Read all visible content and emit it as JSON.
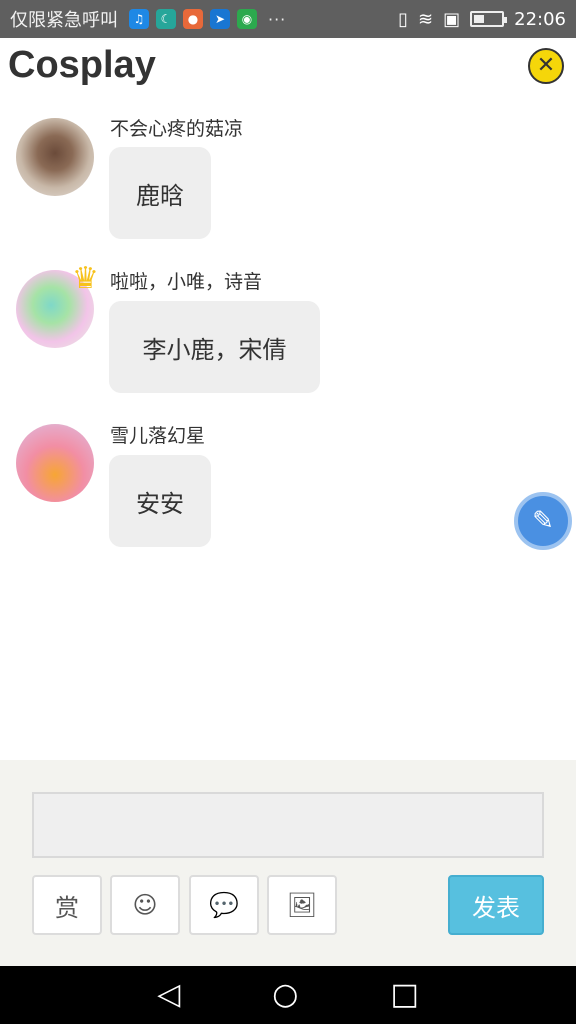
{
  "status_bar": {
    "emergency_text": "仅限紧急呼叫",
    "notification_icons": [
      "qq-icon",
      "moon-icon",
      "weibo-icon",
      "paperplane-icon",
      "wechat-icon"
    ],
    "more": "···",
    "time": "22:06",
    "battery_level": 0.4
  },
  "header": {
    "title": "Cosplay",
    "close_icon": "close-icon"
  },
  "messages": [
    {
      "name": "不会心疼的菇凉",
      "text": "鹿晗"
    },
    {
      "name": "啦啦，小唯，诗音",
      "text": "李小鹿，宋倩"
    },
    {
      "name": "雪儿落幻星",
      "text": "安安"
    }
  ],
  "composer": {
    "input_value": "",
    "reward_label": "赏",
    "send_label": "发表"
  },
  "colors": {
    "accent": "#57c0df",
    "close_button": "#f5d60a",
    "float_button": "#4a90e2"
  }
}
